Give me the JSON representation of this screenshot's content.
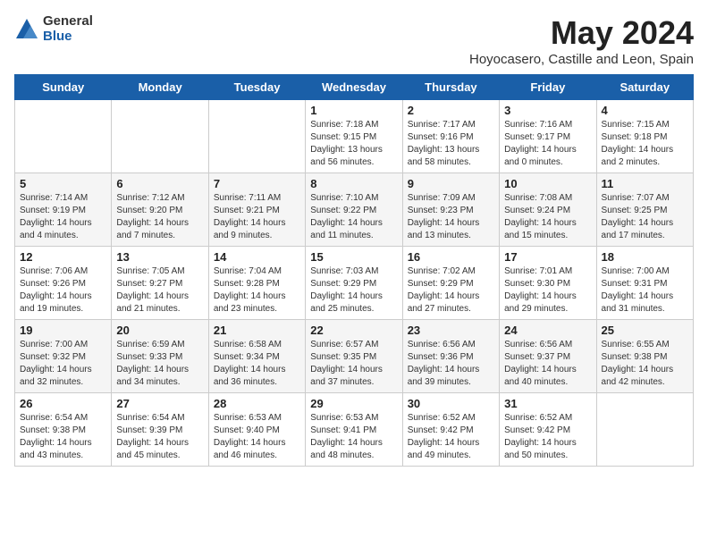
{
  "header": {
    "logo_line1": "General",
    "logo_line2": "Blue",
    "month": "May 2024",
    "location": "Hoyocasero, Castille and Leon, Spain"
  },
  "weekdays": [
    "Sunday",
    "Monday",
    "Tuesday",
    "Wednesday",
    "Thursday",
    "Friday",
    "Saturday"
  ],
  "weeks": [
    [
      {
        "day": "",
        "sunrise": "",
        "sunset": "",
        "daylight": ""
      },
      {
        "day": "",
        "sunrise": "",
        "sunset": "",
        "daylight": ""
      },
      {
        "day": "",
        "sunrise": "",
        "sunset": "",
        "daylight": ""
      },
      {
        "day": "1",
        "sunrise": "Sunrise: 7:18 AM",
        "sunset": "Sunset: 9:15 PM",
        "daylight": "Daylight: 13 hours and 56 minutes."
      },
      {
        "day": "2",
        "sunrise": "Sunrise: 7:17 AM",
        "sunset": "Sunset: 9:16 PM",
        "daylight": "Daylight: 13 hours and 58 minutes."
      },
      {
        "day": "3",
        "sunrise": "Sunrise: 7:16 AM",
        "sunset": "Sunset: 9:17 PM",
        "daylight": "Daylight: 14 hours and 0 minutes."
      },
      {
        "day": "4",
        "sunrise": "Sunrise: 7:15 AM",
        "sunset": "Sunset: 9:18 PM",
        "daylight": "Daylight: 14 hours and 2 minutes."
      }
    ],
    [
      {
        "day": "5",
        "sunrise": "Sunrise: 7:14 AM",
        "sunset": "Sunset: 9:19 PM",
        "daylight": "Daylight: 14 hours and 4 minutes."
      },
      {
        "day": "6",
        "sunrise": "Sunrise: 7:12 AM",
        "sunset": "Sunset: 9:20 PM",
        "daylight": "Daylight: 14 hours and 7 minutes."
      },
      {
        "day": "7",
        "sunrise": "Sunrise: 7:11 AM",
        "sunset": "Sunset: 9:21 PM",
        "daylight": "Daylight: 14 hours and 9 minutes."
      },
      {
        "day": "8",
        "sunrise": "Sunrise: 7:10 AM",
        "sunset": "Sunset: 9:22 PM",
        "daylight": "Daylight: 14 hours and 11 minutes."
      },
      {
        "day": "9",
        "sunrise": "Sunrise: 7:09 AM",
        "sunset": "Sunset: 9:23 PM",
        "daylight": "Daylight: 14 hours and 13 minutes."
      },
      {
        "day": "10",
        "sunrise": "Sunrise: 7:08 AM",
        "sunset": "Sunset: 9:24 PM",
        "daylight": "Daylight: 14 hours and 15 minutes."
      },
      {
        "day": "11",
        "sunrise": "Sunrise: 7:07 AM",
        "sunset": "Sunset: 9:25 PM",
        "daylight": "Daylight: 14 hours and 17 minutes."
      }
    ],
    [
      {
        "day": "12",
        "sunrise": "Sunrise: 7:06 AM",
        "sunset": "Sunset: 9:26 PM",
        "daylight": "Daylight: 14 hours and 19 minutes."
      },
      {
        "day": "13",
        "sunrise": "Sunrise: 7:05 AM",
        "sunset": "Sunset: 9:27 PM",
        "daylight": "Daylight: 14 hours and 21 minutes."
      },
      {
        "day": "14",
        "sunrise": "Sunrise: 7:04 AM",
        "sunset": "Sunset: 9:28 PM",
        "daylight": "Daylight: 14 hours and 23 minutes."
      },
      {
        "day": "15",
        "sunrise": "Sunrise: 7:03 AM",
        "sunset": "Sunset: 9:29 PM",
        "daylight": "Daylight: 14 hours and 25 minutes."
      },
      {
        "day": "16",
        "sunrise": "Sunrise: 7:02 AM",
        "sunset": "Sunset: 9:29 PM",
        "daylight": "Daylight: 14 hours and 27 minutes."
      },
      {
        "day": "17",
        "sunrise": "Sunrise: 7:01 AM",
        "sunset": "Sunset: 9:30 PM",
        "daylight": "Daylight: 14 hours and 29 minutes."
      },
      {
        "day": "18",
        "sunrise": "Sunrise: 7:00 AM",
        "sunset": "Sunset: 9:31 PM",
        "daylight": "Daylight: 14 hours and 31 minutes."
      }
    ],
    [
      {
        "day": "19",
        "sunrise": "Sunrise: 7:00 AM",
        "sunset": "Sunset: 9:32 PM",
        "daylight": "Daylight: 14 hours and 32 minutes."
      },
      {
        "day": "20",
        "sunrise": "Sunrise: 6:59 AM",
        "sunset": "Sunset: 9:33 PM",
        "daylight": "Daylight: 14 hours and 34 minutes."
      },
      {
        "day": "21",
        "sunrise": "Sunrise: 6:58 AM",
        "sunset": "Sunset: 9:34 PM",
        "daylight": "Daylight: 14 hours and 36 minutes."
      },
      {
        "day": "22",
        "sunrise": "Sunrise: 6:57 AM",
        "sunset": "Sunset: 9:35 PM",
        "daylight": "Daylight: 14 hours and 37 minutes."
      },
      {
        "day": "23",
        "sunrise": "Sunrise: 6:56 AM",
        "sunset": "Sunset: 9:36 PM",
        "daylight": "Daylight: 14 hours and 39 minutes."
      },
      {
        "day": "24",
        "sunrise": "Sunrise: 6:56 AM",
        "sunset": "Sunset: 9:37 PM",
        "daylight": "Daylight: 14 hours and 40 minutes."
      },
      {
        "day": "25",
        "sunrise": "Sunrise: 6:55 AM",
        "sunset": "Sunset: 9:38 PM",
        "daylight": "Daylight: 14 hours and 42 minutes."
      }
    ],
    [
      {
        "day": "26",
        "sunrise": "Sunrise: 6:54 AM",
        "sunset": "Sunset: 9:38 PM",
        "daylight": "Daylight: 14 hours and 43 minutes."
      },
      {
        "day": "27",
        "sunrise": "Sunrise: 6:54 AM",
        "sunset": "Sunset: 9:39 PM",
        "daylight": "Daylight: 14 hours and 45 minutes."
      },
      {
        "day": "28",
        "sunrise": "Sunrise: 6:53 AM",
        "sunset": "Sunset: 9:40 PM",
        "daylight": "Daylight: 14 hours and 46 minutes."
      },
      {
        "day": "29",
        "sunrise": "Sunrise: 6:53 AM",
        "sunset": "Sunset: 9:41 PM",
        "daylight": "Daylight: 14 hours and 48 minutes."
      },
      {
        "day": "30",
        "sunrise": "Sunrise: 6:52 AM",
        "sunset": "Sunset: 9:42 PM",
        "daylight": "Daylight: 14 hours and 49 minutes."
      },
      {
        "day": "31",
        "sunrise": "Sunrise: 6:52 AM",
        "sunset": "Sunset: 9:42 PM",
        "daylight": "Daylight: 14 hours and 50 minutes."
      },
      {
        "day": "",
        "sunrise": "",
        "sunset": "",
        "daylight": ""
      }
    ]
  ]
}
